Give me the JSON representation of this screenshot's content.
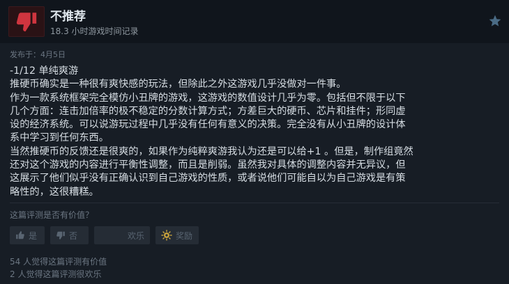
{
  "review": {
    "verdict": "不推荐",
    "hours": "18.3 小时游戏时间记录",
    "posted": "发布于：4月5日",
    "body_lines": [
      "-1/12 单纯爽游",
      "推硬币确实是一种很有爽快感的玩法，但除此之外这游戏几乎没做对一件事。",
      "作为一款系统框架完全模仿小丑牌的游戏，这游戏的数值设计几乎为零。包括但不限于以下",
      "几个方面：连击加倍率的极不稳定的分数计算方式；方差巨大的硬币、芯片和挂件；形同虚",
      "设的经济系统。可以说游玩过程中几乎没有任何有意义的决策。完全没有从小丑牌的设计体",
      "系中学习到任何东西。",
      "当然推硬币的反馈还是很爽的，如果作为纯粹爽游我认为还是可以给+1 。但是，制作组竟然",
      "还对这个游戏的内容进行平衡性调整，而且是削弱。虽然我对具体的调整内容并无异议，但",
      "这展示了他们似乎没有正确认识到自己游戏的性质，或者说他们可能自以为自己游戏是有策",
      "略性的，这很糟糕。"
    ]
  },
  "feedback": {
    "question": "这篇评测是否有价值？",
    "yes_label": "是",
    "no_label": "否",
    "funny_label": "欢乐",
    "award_label": "奖励",
    "helpful_count": "54 人觉得这篇评测有价值",
    "funny_count": "2 人觉得这篇评测很欢乐"
  },
  "icons": {
    "verdict": "thumbs-down-icon",
    "star": "star-icon",
    "yes": "thumbs-up-icon",
    "no": "thumbs-down-icon",
    "award": "award-icon"
  },
  "colors": {
    "thumb_red": "#d0353f",
    "star": "#4a6b85"
  }
}
